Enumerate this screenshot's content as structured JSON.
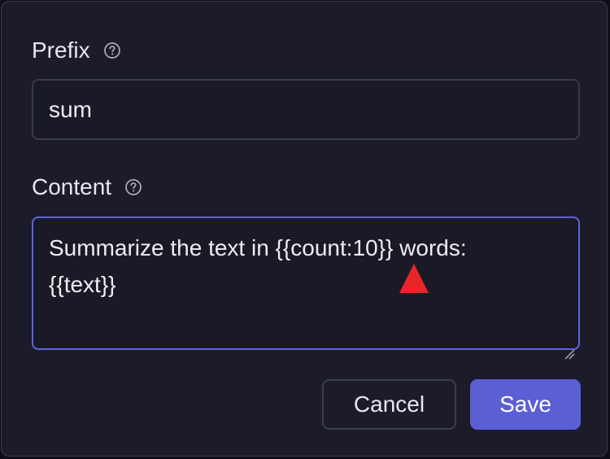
{
  "form": {
    "prefix": {
      "label": "Prefix",
      "value": "sum",
      "help_icon": "question-circle-icon"
    },
    "content": {
      "label": "Content",
      "lines": [
        "Summarize the text in {{count:10}} words:",
        "{{text}}"
      ],
      "help_icon": "question-circle-icon"
    }
  },
  "actions": {
    "cancel_label": "Cancel",
    "save_label": "Save"
  },
  "colors": {
    "accent": "#5b5fd4",
    "focus_border": "#5f63d6",
    "background": "#1c1b2a",
    "marker": "#e8262a"
  }
}
